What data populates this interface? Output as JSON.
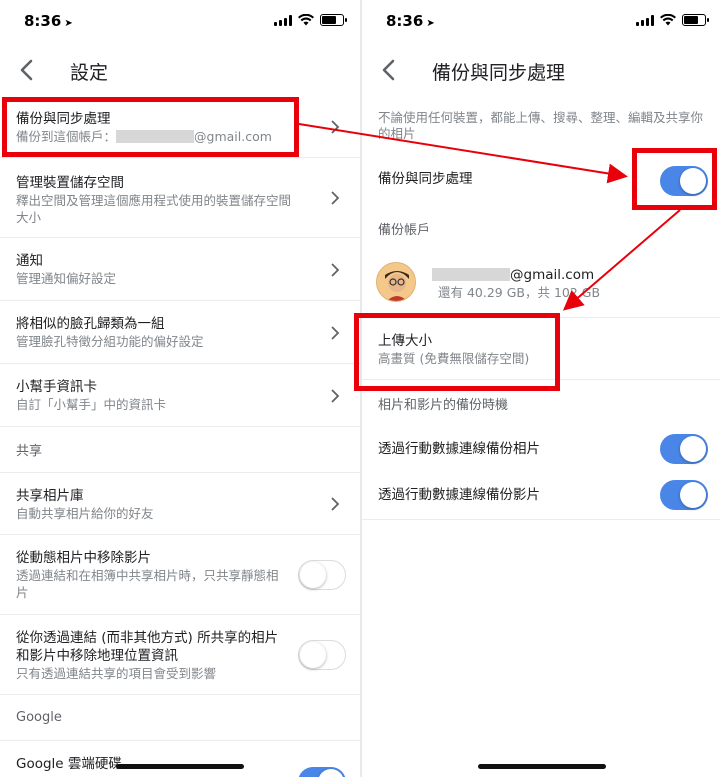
{
  "status": {
    "time": "8:36",
    "location_icon": "location-arrow-icon"
  },
  "left": {
    "title": "設定",
    "rows": [
      {
        "title": "備份與同步處理",
        "subtitle_prefix": "備份到這個帳戶：",
        "subtitle_suffix": "@gmail.com"
      },
      {
        "title": "管理裝置儲存空間",
        "subtitle": "釋出空間及管理這個應用程式使用的裝置儲存空間大小"
      },
      {
        "title": "通知",
        "subtitle": "管理通知偏好設定"
      },
      {
        "title": "將相似的臉孔歸類為一組",
        "subtitle": "管理臉孔特徵分組功能的偏好設定"
      },
      {
        "title": "小幫手資訊卡",
        "subtitle": "自訂「小幫手」中的資訊卡"
      }
    ],
    "section_share": "共享",
    "share_rows": [
      {
        "title": "共享相片庫",
        "subtitle": "自動共享相片給你的好友"
      },
      {
        "title": "從動態相片中移除影片",
        "subtitle": "透過連結和在相簿中共享相片時，只共享靜態相片",
        "toggle": false
      },
      {
        "title": "從你透過連結 (而非其他方式) 所共享的相片和影片中移除地理位置資訊",
        "subtitle": "只有透過連結共享的項目會受到影響",
        "toggle": false
      }
    ],
    "section_google": "Google",
    "google_drive": {
      "title": "Google 雲端硬碟",
      "toggle": true
    }
  },
  "right": {
    "title": "備份與同步處理",
    "description": "不論使用任何裝置，都能上傳、搜尋、整理、編輯及共享你的相片",
    "backup_toggle": {
      "label": "備份與同步處理",
      "on": true
    },
    "account_section": "備份帳戶",
    "account": {
      "email_suffix": "@gmail.com",
      "storage": "還有 40.29 GB，共 102 GB"
    },
    "upload_size": {
      "title": "上傳大小",
      "subtitle": "高畫質 (免費無限儲存空間)"
    },
    "timing_section": "相片和影片的備份時機",
    "cellular_photos": {
      "label": "透過行動數據連線備份相片",
      "on": true
    },
    "cellular_videos": {
      "label": "透過行動數據連線備份影片",
      "on": true
    }
  },
  "colors": {
    "toggle_on": "#4a86e8",
    "highlight": "#e8000b"
  }
}
